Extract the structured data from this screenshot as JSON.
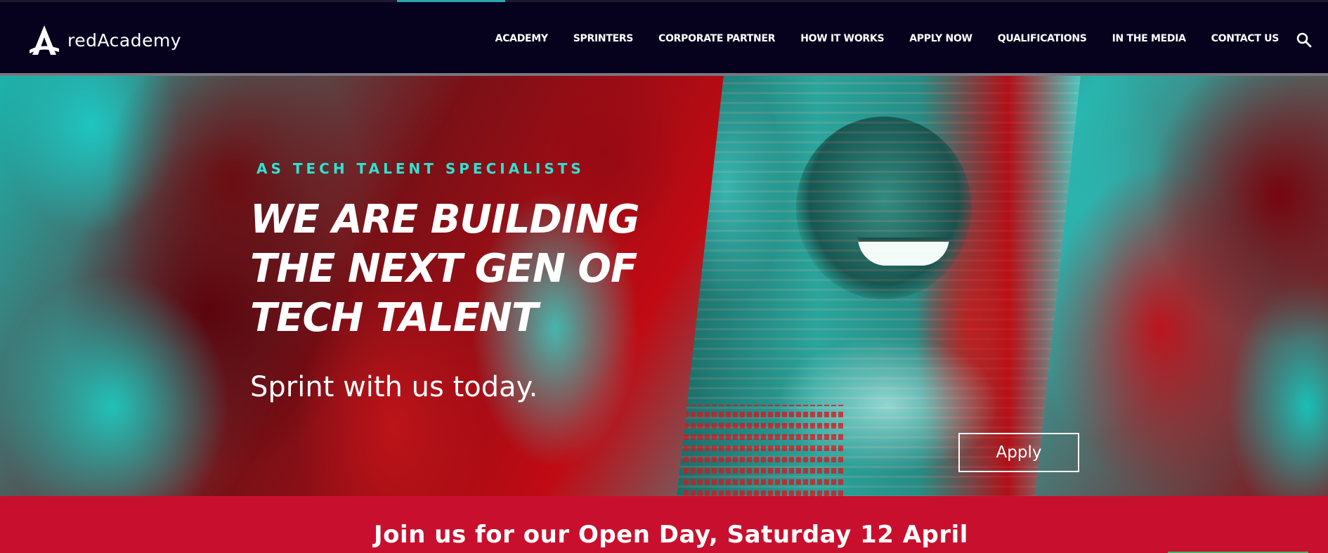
{
  "header": {
    "logo_text": "redAcademy",
    "nav": [
      {
        "label": "ACADEMY"
      },
      {
        "label": "SPRINTERS"
      },
      {
        "label": "CORPORATE PARTNER"
      },
      {
        "label": "HOW IT WORKS"
      },
      {
        "label": "APPLY NOW"
      },
      {
        "label": "QUALIFICATIONS"
      },
      {
        "label": "IN THE MEDIA"
      },
      {
        "label": "CONTACT US"
      }
    ],
    "search_icon": "search-icon"
  },
  "hero": {
    "eyebrow": "AS TECH TALENT SPECIALISTS",
    "headline_lines": [
      "WE ARE BUILDING",
      "THE NEXT GEN OF",
      "TECH TALENT"
    ],
    "subline": "Sprint with us today.",
    "apply_label": "Apply"
  },
  "banner": {
    "text": "Join us for our Open Day, Saturday 12 April"
  },
  "colors": {
    "header_bg": "#06021e",
    "accent_teal": "#2ee3d2",
    "banner_red": "#c8102e",
    "text_white": "#ffffff"
  }
}
